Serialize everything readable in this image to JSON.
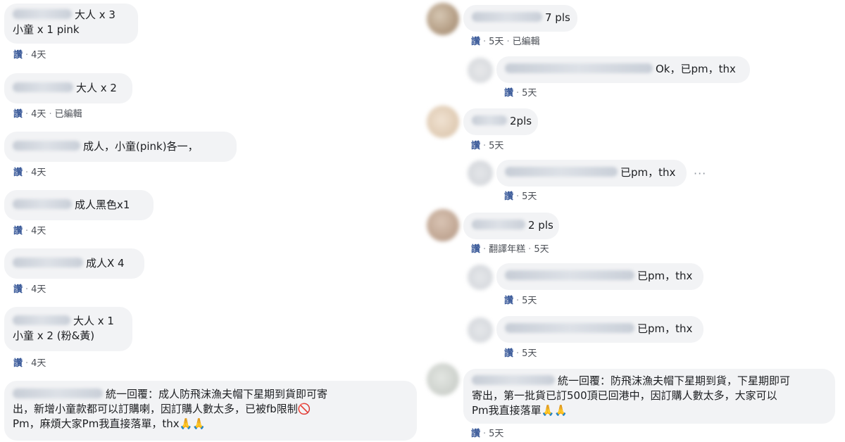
{
  "left_comments": [
    {
      "text_lines": [
        "大人 x 3",
        "小童 x 1 pink"
      ],
      "actions": {
        "like": "讚",
        "time": "4天"
      }
    },
    {
      "text_lines": [
        "大人 x 2"
      ],
      "actions": {
        "like": "讚",
        "time": "4天",
        "edited": "已編輯"
      }
    },
    {
      "text_lines": [
        "成人，小童(pink)各一，"
      ],
      "actions": {
        "like": "讚",
        "time": "4天"
      }
    },
    {
      "text_lines": [
        "成人黑色x1"
      ],
      "actions": {
        "like": "讚",
        "time": "4天"
      }
    },
    {
      "text_lines": [
        "成人X 4"
      ],
      "actions": {
        "like": "讚",
        "time": "4天"
      }
    },
    {
      "text_lines": [
        "大人 x 1",
        "小童 x 2 (粉&黃)"
      ],
      "actions": {
        "like": "讚",
        "time": "4天"
      }
    },
    {
      "text_lines": [
        "統一回覆：成人防飛沫漁夫帽下星期到貨即可寄",
        "出，新增小童款都可以訂購喇，因訂購人數太多，已被fb限制🚫",
        "Pm，麻煩大家Pm我直接落單，thx🙏🙏"
      ],
      "actions": {
        "like": "讚",
        "time": "4天"
      }
    }
  ],
  "right_comments": [
    {
      "text": "7 pls",
      "actions": {
        "like": "讚",
        "time": "5天",
        "edited": "已編輯"
      }
    },
    {
      "text": "Ok，已pm，thx",
      "actions": {
        "like": "讚",
        "time": "5天"
      }
    },
    {
      "text": "2pls",
      "actions": {
        "like": "讚",
        "time": "5天"
      }
    },
    {
      "text": "已pm，thx",
      "actions": {
        "like": "讚",
        "time": "5天"
      },
      "more": "···"
    },
    {
      "text": "2 pls",
      "actions": {
        "like": "讚",
        "translate": "翻譯年糕",
        "time": "5天"
      }
    },
    {
      "text": "已pm，thx",
      "actions": {
        "like": "讚",
        "time": "5天"
      }
    },
    {
      "text": "已pm，thx",
      "actions": {
        "like": "讚",
        "time": "5天"
      }
    },
    {
      "text_lines": [
        "統一回覆：防飛沫漁夫帽下星期到貨，下星期即可",
        "寄出，第一批貨已訂500頂已回港中，因訂購人數太多，大家可以",
        "Pm我直接落單🙏🙏"
      ],
      "actions": {
        "like": "讚",
        "time": "5天"
      }
    }
  ],
  "colors": {
    "bubble": "#f2f3f5",
    "like": "#385898",
    "meta": "#4b4f56"
  }
}
